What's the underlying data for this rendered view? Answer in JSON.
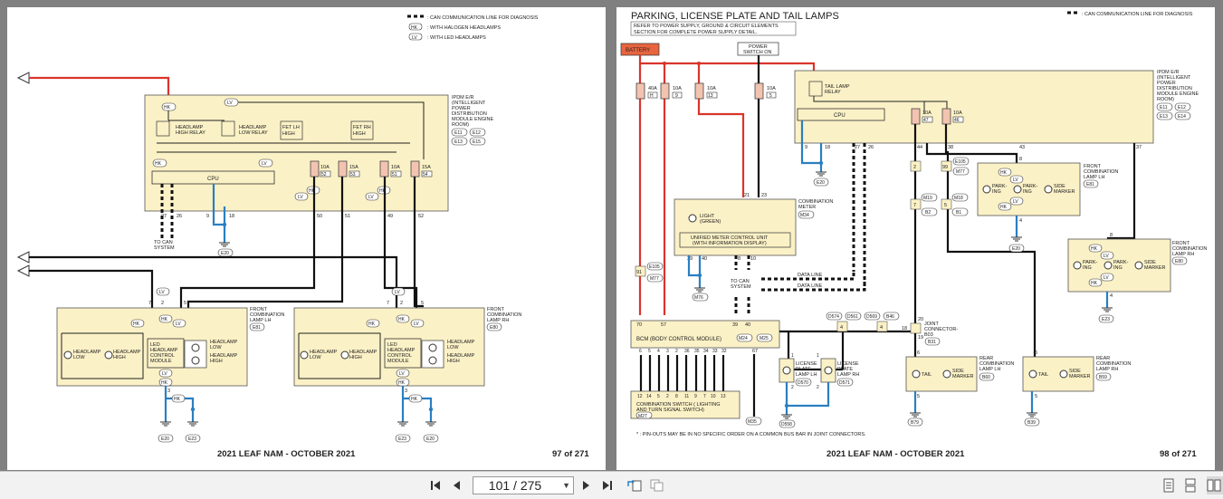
{
  "left_page": {
    "legend": [
      {
        "sym": "",
        "text": ": CAN COMMUNICATION LINE FOR DIAGNOSIS"
      },
      {
        "sym": "HK",
        "text": ": WITH HALOGEN HEADLAMPS"
      },
      {
        "sym": "LV",
        "text": ": WITH LED HEADLAMPS"
      }
    ],
    "ipdm_label": [
      "IPDM E/R",
      "(INTELLIGENT",
      "POWER",
      "DISTRIBUTION",
      "MODULE ENGINE",
      "ROOM)"
    ],
    "ipdm_connectors": [
      "E11",
      "E12",
      "E13",
      "E15"
    ],
    "relays": {
      "high": [
        "HEADLAMP",
        "HIGH RELAY"
      ],
      "low": [
        "HEADLAMP",
        "LOW RELAY"
      ]
    },
    "fets": {
      "lh": [
        "FET LH",
        "HIGH"
      ],
      "rh": [
        "FET RH",
        "HIGH"
      ]
    },
    "cpu": "CPU",
    "fuses": [
      {
        "amp": "10A",
        "num": "52"
      },
      {
        "amp": "15A",
        "num": "53"
      },
      {
        "amp": "10A",
        "num": "51"
      },
      {
        "amp": "15A",
        "num": "54"
      }
    ],
    "terminals": [
      "27",
      "26",
      "9",
      "18",
      "50",
      "51",
      "49",
      "52"
    ],
    "to_can": [
      "TO CAN",
      "SYSTEM"
    ],
    "e20": "E20",
    "lamp_lh": {
      "name": [
        "FRONT",
        "COMBINATION",
        "LAMP LH"
      ],
      "conn": "E81",
      "pins": [
        "7",
        "2",
        "5",
        "3"
      ],
      "module": [
        "LED",
        "HEADLAMP",
        "CONTROL",
        "MODULE"
      ],
      "low": [
        "HEADLAMP",
        "LOW"
      ],
      "high": [
        "HEADLAMP",
        "HIGH"
      ],
      "led_low": [
        "HEADLAMP",
        "LOW"
      ],
      "led_high": [
        "HEADLAMP",
        "HIGH"
      ],
      "grounds": [
        "E20",
        "E23"
      ]
    },
    "lamp_rh": {
      "name": [
        "FRONT",
        "COMBINATION",
        "LAMP RH"
      ],
      "conn": "E80",
      "pins": [
        "7",
        "2",
        "5",
        "3"
      ],
      "module": [
        "LED",
        "HEADLAMP",
        "CONTROL",
        "MODULE"
      ],
      "low": [
        "HEADLAMP",
        "LOW"
      ],
      "high": [
        "HEADLAMP",
        "HIGH"
      ],
      "led_low": [
        "HEADLAMP",
        "LOW"
      ],
      "led_high": [
        "HEADLAMP",
        "HIGH"
      ],
      "grounds": [
        "E23",
        "E20"
      ]
    },
    "footer_title": "2021 LEAF NAM - OCTOBER 2021",
    "page_no": "97 of 271"
  },
  "right_page": {
    "title": "PARKING, LICENSE PLATE AND TAIL LAMPS",
    "refer_note": [
      "REFER TO POWER SUPPLY, GROUND & CIRCUIT ELEMENTS",
      "SECTION FOR COMPLETE POWER SUPPLY DETAIL."
    ],
    "legend": ": CAN COMMUNICATION LINE FOR DIAGNOSIS",
    "battery": "BATTERY",
    "power_switch": [
      "POWER",
      "SWITCH ON"
    ],
    "fuses": [
      {
        "amp": "40A",
        "num": "H"
      },
      {
        "amp": "10A",
        "num": "9"
      },
      {
        "amp": "10A",
        "num": "13"
      },
      {
        "amp": "10A",
        "num": "5"
      }
    ],
    "ipdm_label": [
      "IPDM E/R",
      "(INTELLIGENT",
      "POWER",
      "DISTRIBUTION",
      "MODULE ENGINE",
      "ROOM)"
    ],
    "ipdm_connectors": [
      "E11",
      "E12",
      "E13",
      "E14"
    ],
    "tail_relay": [
      "TAIL LAMP",
      "RELAY"
    ],
    "cpu": "CPU",
    "ipdm_fuses": [
      {
        "amp": "10A",
        "num": "47"
      },
      {
        "amp": "10A",
        "num": "46"
      }
    ],
    "terminals": [
      "9",
      "18",
      "27",
      "26",
      "44",
      "38",
      "43",
      "37",
      "21",
      "23"
    ],
    "e20": "E20",
    "e105": "E105",
    "m77": "M77",
    "pin_2": "2",
    "pin_99": "99",
    "combination_meter": {
      "name": [
        "COMBINATION",
        "METER"
      ],
      "conn": "M34",
      "light": [
        "LIGHT",
        "(GREEN)"
      ],
      "unit": [
        "UNIFIED METER CONTROL UNIT",
        "(WITH INFORMATION DISPLAY)"
      ],
      "pins": [
        "39",
        "40",
        "8",
        "10"
      ],
      "ground": "M76"
    },
    "to_can": [
      "TO CAN",
      "SYSTEM"
    ],
    "data_line": "DATA LINE",
    "m19": "M19",
    "b2": "B2",
    "m18": "M18",
    "b1": "B1",
    "pin_7": "7",
    "pin_5": "5",
    "front_lh": {
      "name": [
        "FRONT",
        "COMBINATION",
        "LAMP LH"
      ],
      "conn": "E81",
      "pins": [
        "8",
        "4"
      ],
      "ground": "E20",
      "parking1": [
        "PARK-",
        "ING"
      ],
      "parking2": [
        "PARK-",
        "ING"
      ],
      "side": [
        "SIDE",
        "MARKER"
      ]
    },
    "front_rh": {
      "name": [
        "FRONT",
        "COMBINATION",
        "LAMP RH"
      ],
      "conn": "E80",
      "pins": [
        "8",
        "4"
      ],
      "ground": "E23",
      "parking1": [
        "PARK-",
        "ING"
      ],
      "parking2": [
        "PARK-",
        "ING"
      ],
      "side": [
        "SIDE",
        "MARKER"
      ]
    },
    "pin_91": "91",
    "bcm": {
      "label": "BCM (BODY CONTROL MODULE)",
      "conns": [
        "M24",
        "M25"
      ],
      "pins": [
        "70",
        "57",
        "39",
        "40",
        "67"
      ]
    },
    "bcm_row": [
      "6",
      "5",
      "4",
      "3",
      "2",
      "36",
      "35",
      "34",
      "33",
      "32"
    ],
    "combo_switch": {
      "pins": [
        "12",
        "14",
        "5",
        "2",
        "8",
        "11",
        "9",
        "7",
        "10",
        "13"
      ],
      "label": [
        "COMBINATION SWITCH ( LIGHTING",
        "AND TURN SIGNAL SWITCH)"
      ],
      "conn": "M27"
    },
    "m35": "M35",
    "joint_conns": [
      "D574",
      "D561",
      "D569",
      "B46"
    ],
    "joint_pins": [
      "4",
      "4",
      "18",
      "20",
      "19"
    ],
    "joint_connector": [
      "JOINT",
      "CONNECTOR-",
      "B03"
    ],
    "b31": "B31",
    "license_lh": {
      "name": [
        "LICENSE",
        "PLATE",
        "LAMP LH"
      ],
      "conn": "D570",
      "ground": "D558",
      "pins": [
        "1",
        "2"
      ]
    },
    "license_rh": {
      "name": [
        "LICENSE",
        "PLATE",
        "LAMP RH"
      ],
      "conn": "D571",
      "pins": [
        "1",
        "2"
      ]
    },
    "rear_lh": {
      "name": [
        "REAR",
        "COMBINATION",
        "LAMP LH"
      ],
      "conn": "B60",
      "pins": [
        "6",
        "5"
      ],
      "ground": "B79",
      "tail": "TAIL",
      "side": [
        "SIDE",
        "MARKER"
      ]
    },
    "rear_rh": {
      "name": [
        "REAR",
        "COMBINATION",
        "LAMP RH"
      ],
      "conn": "B59",
      "pins": [
        "6",
        "5"
      ],
      "ground": "B39",
      "tail": "TAIL",
      "side": [
        "SIDE",
        "MARKER"
      ]
    },
    "footnote": "* : PIN-OUTS MAY BE IN NO SPECIFIC ORDER ON A COMMON BUS BAR IN JOINT CONNECTORS.",
    "footer_title": "2021 LEAF NAM - OCTOBER 2021",
    "page_no": "98 of 271"
  },
  "toolbar": {
    "page_value": "101 / 275",
    "icons": [
      "first-page-icon",
      "prev-page-icon",
      "next-page-icon",
      "last-page-icon",
      "rotate-icon",
      "copy-icon",
      "single-page-view-icon",
      "continuous-view-icon",
      "two-page-view-icon"
    ]
  }
}
